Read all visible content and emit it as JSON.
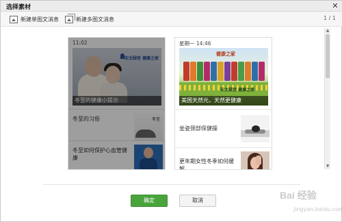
{
  "dialog": {
    "title": "选择素材",
    "close_glyph": "✕"
  },
  "toolbar": {
    "new_single_label": "新建单图文消息",
    "new_multi_label": "新建多图文消息",
    "pager": "1 / 1"
  },
  "scrollbar": {
    "up_glyph": "▲",
    "down_glyph": "▼"
  },
  "cards": [
    {
      "date": "11:02",
      "selected": true,
      "cover_caption": "冬至的健康小提示",
      "cover_logo": "安太颐宫 健康之家",
      "items": [
        {
          "title": "冬至的习俗",
          "thumb_text": "冬至"
        },
        {
          "title": "冬至如何保护心血管健康"
        }
      ]
    },
    {
      "date": "星期一 14:46",
      "selected": false,
      "cover_caption": "美国天然元，天然更健康",
      "cover_logo": "健康之家",
      "cover_logo2": "安太颐宫 健康之家",
      "items": [
        {
          "title": "坐姿颈部保健操"
        },
        {
          "title": "更年期女性冬季如何缓解"
        }
      ]
    }
  ],
  "footer": {
    "ok_label": "确定",
    "cancel_label": "取消"
  },
  "watermark": {
    "text": "Bai 经验",
    "sub": "jingyan.baidu.com"
  },
  "colors": {
    "ok_button": "#49a43c",
    "title_bar": "#ececec",
    "toolbar": "#f6f6f6"
  }
}
